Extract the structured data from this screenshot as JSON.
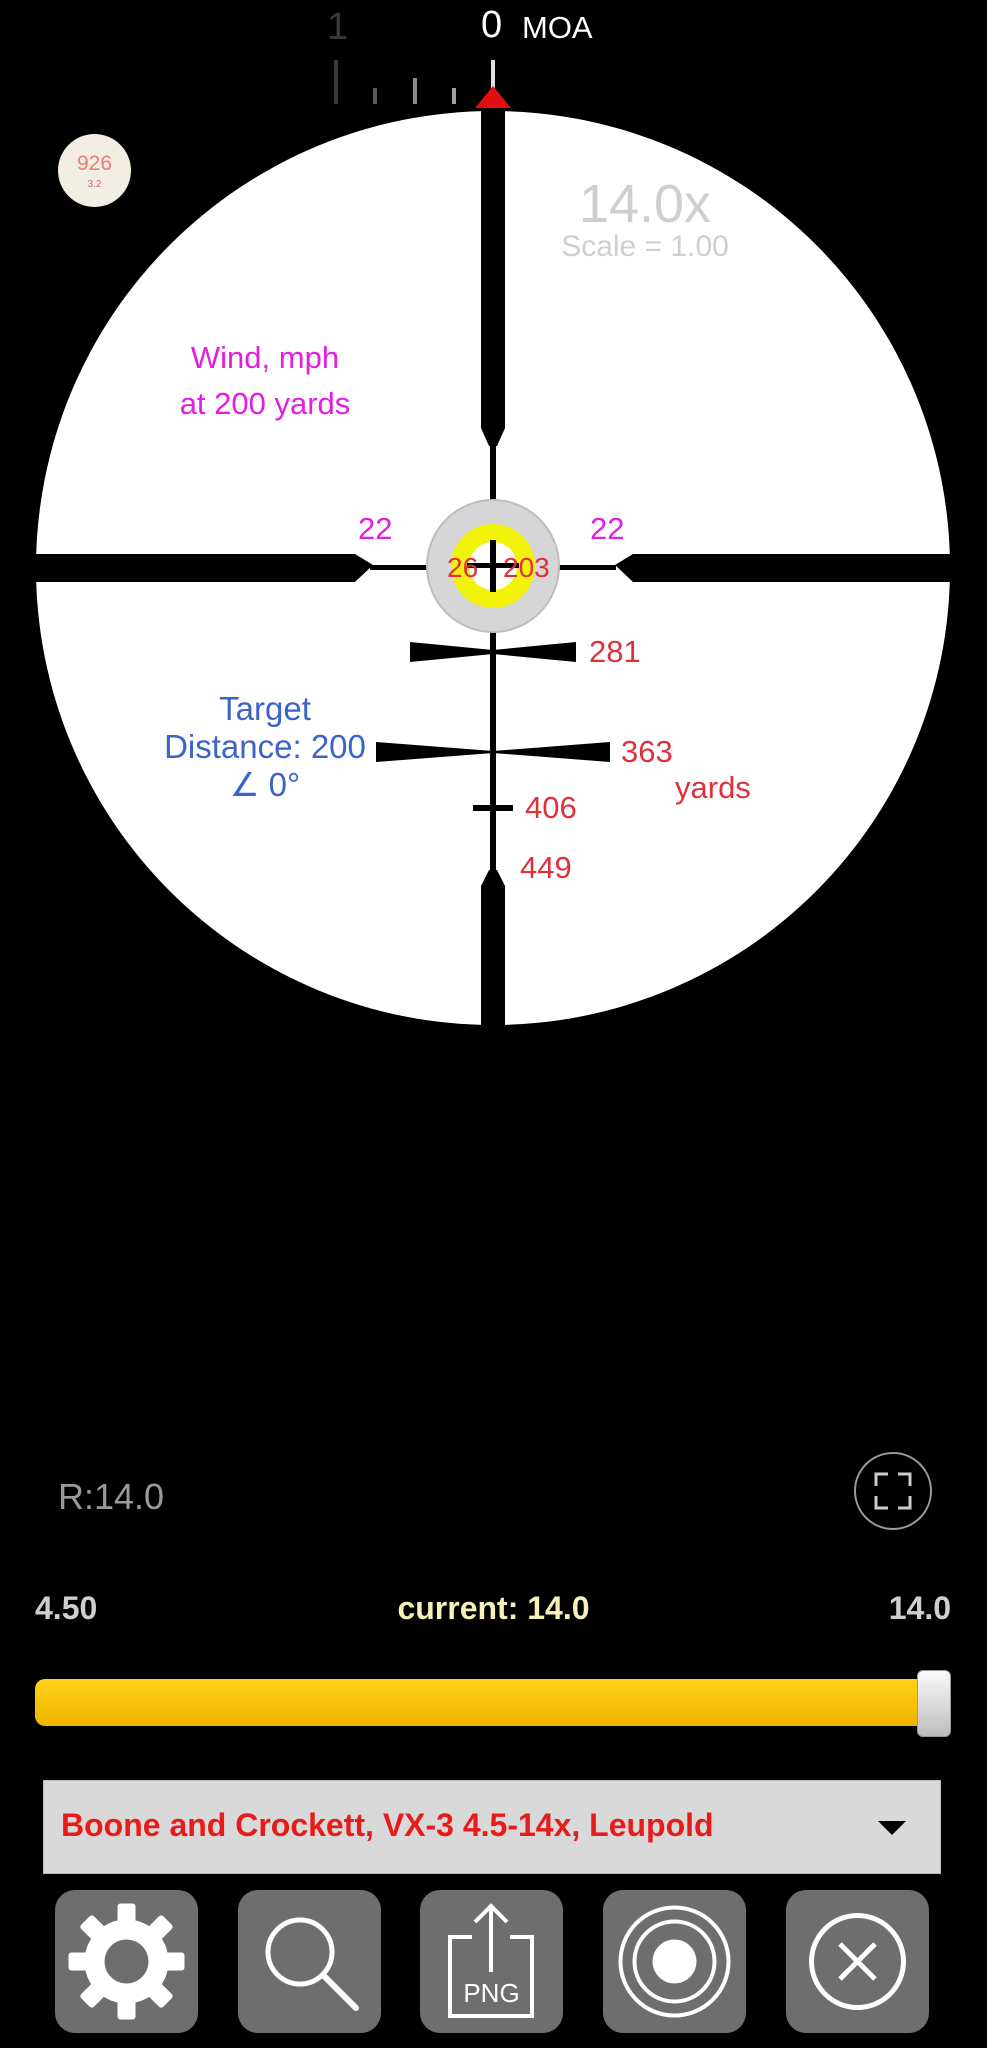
{
  "moa_scale": {
    "left_value": "1",
    "zero_value": "0",
    "unit": "MOA"
  },
  "badge": {
    "primary": "926",
    "secondary": "3.2"
  },
  "scope": {
    "zoom": "14.0x",
    "scale": "Scale = 1.00",
    "wind_title": [
      "Wind, mph",
      "at 200 yards"
    ],
    "wind_left": "22",
    "wind_right": "22",
    "center_left": "26",
    "center_right": "203",
    "marks": [
      "281",
      "363",
      "406",
      "449"
    ],
    "yards_label": "yards",
    "target_lines": [
      "Target",
      "Distance: 200",
      "∠ 0°"
    ]
  },
  "readout": {
    "r_label": "R:14.0"
  },
  "magnification": {
    "min": "4.50",
    "current_label": "current: 14.0",
    "max": "14.0",
    "current": 14.0,
    "min_value": 4.5,
    "max_value": 14.0
  },
  "reticle_select": {
    "selected": "Boone and Crockett, VX-3 4.5-14x, Leupold"
  },
  "toolbar": {
    "png_label": "PNG"
  },
  "icons": [
    "gear-icon",
    "magnifier-icon",
    "png-export-icon",
    "target-icon",
    "close-icon",
    "fullscreen-icon",
    "dropdown-arrow-icon"
  ],
  "colors": {
    "accent_yellow": "#f5c100",
    "wind_magenta": "#e21ee2",
    "range_red": "#e0303a",
    "target_blue": "#3b63c8"
  }
}
